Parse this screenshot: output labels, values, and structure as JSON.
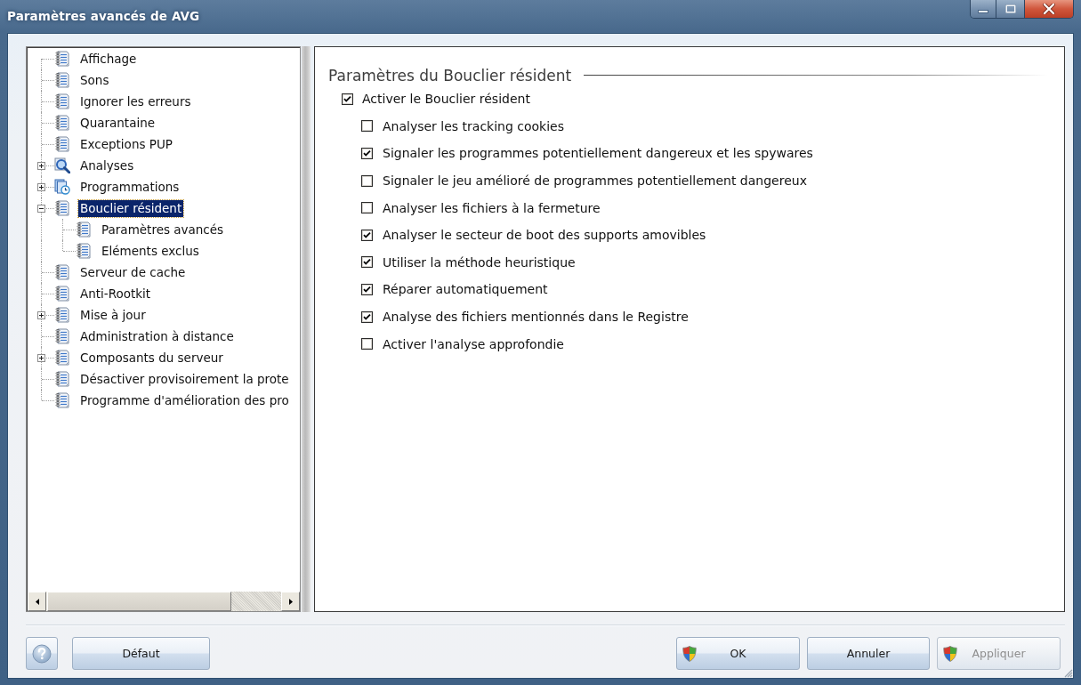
{
  "window": {
    "title": "Paramètres avancés de AVG"
  },
  "tree": {
    "items": [
      {
        "label": "Affichage",
        "kind": "document",
        "selected": false
      },
      {
        "label": "Sons",
        "kind": "document",
        "selected": false
      },
      {
        "label": "Ignorer les erreurs",
        "kind": "document",
        "selected": false
      },
      {
        "label": "Quarantaine",
        "kind": "document",
        "selected": false
      },
      {
        "label": "Exceptions PUP",
        "kind": "document",
        "selected": false
      },
      {
        "label": "Analyses",
        "kind": "scan",
        "selected": false,
        "expanded": false
      },
      {
        "label": "Programmations",
        "kind": "schedule",
        "selected": false,
        "expanded": false
      },
      {
        "label": "Bouclier résident",
        "kind": "document",
        "selected": true,
        "expanded": true,
        "children": [
          {
            "label": "Paramètres avancés",
            "kind": "document",
            "selected": false
          },
          {
            "label": "Eléments exclus",
            "kind": "document",
            "selected": false
          }
        ]
      },
      {
        "label": "Serveur de cache",
        "kind": "document",
        "selected": false
      },
      {
        "label": "Anti-Rootkit",
        "kind": "document",
        "selected": false
      },
      {
        "label": "Mise à jour",
        "kind": "document",
        "selected": false,
        "expanded": false
      },
      {
        "label": "Administration à distance",
        "kind": "document",
        "selected": false
      },
      {
        "label": "Composants du serveur",
        "kind": "document",
        "selected": false,
        "expanded": false
      },
      {
        "label": "Désactiver provisoirement la prote",
        "kind": "document",
        "selected": false
      },
      {
        "label": "Programme d'amélioration des pro",
        "kind": "document",
        "selected": false
      }
    ]
  },
  "panel": {
    "title": "Paramètres du Bouclier résident",
    "main_option": {
      "label": "Activer le Bouclier résident",
      "checked": true
    },
    "options": [
      {
        "label": "Analyser les tracking cookies",
        "checked": false
      },
      {
        "label": "Signaler les programmes potentiellement dangereux et les spywares",
        "checked": true
      },
      {
        "label": "Signaler le jeu amélioré de programmes potentiellement dangereux",
        "checked": false
      },
      {
        "label": "Analyser les fichiers à la fermeture",
        "checked": false
      },
      {
        "label": "Analyser le secteur de boot des supports amovibles",
        "checked": true
      },
      {
        "label": "Utiliser la méthode heuristique",
        "checked": true
      },
      {
        "label": "Réparer automatiquement",
        "checked": true
      },
      {
        "label": "Analyse des fichiers mentionnés dans le Registre",
        "checked": true
      },
      {
        "label": "Activer l'analyse approfondie",
        "checked": false
      }
    ]
  },
  "footer": {
    "left_buttons": [
      {
        "label": "Défaut",
        "has_icon": false,
        "disabled": false
      }
    ],
    "right_buttons": [
      {
        "label": "OK",
        "has_icon": true,
        "disabled": false
      },
      {
        "label": "Annuler",
        "has_icon": false,
        "disabled": false
      },
      {
        "label": "Appliquer",
        "has_icon": true,
        "disabled": true
      }
    ]
  }
}
